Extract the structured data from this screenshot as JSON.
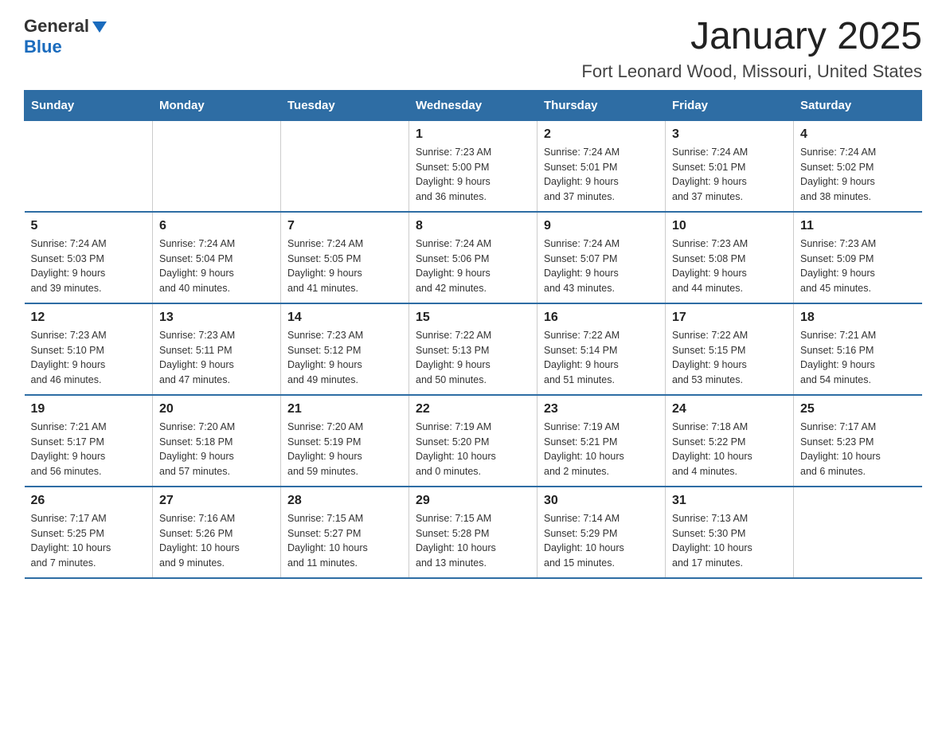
{
  "logo": {
    "general": "General",
    "blue": "Blue"
  },
  "title": "January 2025",
  "subtitle": "Fort Leonard Wood, Missouri, United States",
  "weekdays": [
    "Sunday",
    "Monday",
    "Tuesday",
    "Wednesday",
    "Thursday",
    "Friday",
    "Saturday"
  ],
  "weeks": [
    [
      {
        "day": "",
        "info": ""
      },
      {
        "day": "",
        "info": ""
      },
      {
        "day": "",
        "info": ""
      },
      {
        "day": "1",
        "info": "Sunrise: 7:23 AM\nSunset: 5:00 PM\nDaylight: 9 hours\nand 36 minutes."
      },
      {
        "day": "2",
        "info": "Sunrise: 7:24 AM\nSunset: 5:01 PM\nDaylight: 9 hours\nand 37 minutes."
      },
      {
        "day": "3",
        "info": "Sunrise: 7:24 AM\nSunset: 5:01 PM\nDaylight: 9 hours\nand 37 minutes."
      },
      {
        "day": "4",
        "info": "Sunrise: 7:24 AM\nSunset: 5:02 PM\nDaylight: 9 hours\nand 38 minutes."
      }
    ],
    [
      {
        "day": "5",
        "info": "Sunrise: 7:24 AM\nSunset: 5:03 PM\nDaylight: 9 hours\nand 39 minutes."
      },
      {
        "day": "6",
        "info": "Sunrise: 7:24 AM\nSunset: 5:04 PM\nDaylight: 9 hours\nand 40 minutes."
      },
      {
        "day": "7",
        "info": "Sunrise: 7:24 AM\nSunset: 5:05 PM\nDaylight: 9 hours\nand 41 minutes."
      },
      {
        "day": "8",
        "info": "Sunrise: 7:24 AM\nSunset: 5:06 PM\nDaylight: 9 hours\nand 42 minutes."
      },
      {
        "day": "9",
        "info": "Sunrise: 7:24 AM\nSunset: 5:07 PM\nDaylight: 9 hours\nand 43 minutes."
      },
      {
        "day": "10",
        "info": "Sunrise: 7:23 AM\nSunset: 5:08 PM\nDaylight: 9 hours\nand 44 minutes."
      },
      {
        "day": "11",
        "info": "Sunrise: 7:23 AM\nSunset: 5:09 PM\nDaylight: 9 hours\nand 45 minutes."
      }
    ],
    [
      {
        "day": "12",
        "info": "Sunrise: 7:23 AM\nSunset: 5:10 PM\nDaylight: 9 hours\nand 46 minutes."
      },
      {
        "day": "13",
        "info": "Sunrise: 7:23 AM\nSunset: 5:11 PM\nDaylight: 9 hours\nand 47 minutes."
      },
      {
        "day": "14",
        "info": "Sunrise: 7:23 AM\nSunset: 5:12 PM\nDaylight: 9 hours\nand 49 minutes."
      },
      {
        "day": "15",
        "info": "Sunrise: 7:22 AM\nSunset: 5:13 PM\nDaylight: 9 hours\nand 50 minutes."
      },
      {
        "day": "16",
        "info": "Sunrise: 7:22 AM\nSunset: 5:14 PM\nDaylight: 9 hours\nand 51 minutes."
      },
      {
        "day": "17",
        "info": "Sunrise: 7:22 AM\nSunset: 5:15 PM\nDaylight: 9 hours\nand 53 minutes."
      },
      {
        "day": "18",
        "info": "Sunrise: 7:21 AM\nSunset: 5:16 PM\nDaylight: 9 hours\nand 54 minutes."
      }
    ],
    [
      {
        "day": "19",
        "info": "Sunrise: 7:21 AM\nSunset: 5:17 PM\nDaylight: 9 hours\nand 56 minutes."
      },
      {
        "day": "20",
        "info": "Sunrise: 7:20 AM\nSunset: 5:18 PM\nDaylight: 9 hours\nand 57 minutes."
      },
      {
        "day": "21",
        "info": "Sunrise: 7:20 AM\nSunset: 5:19 PM\nDaylight: 9 hours\nand 59 minutes."
      },
      {
        "day": "22",
        "info": "Sunrise: 7:19 AM\nSunset: 5:20 PM\nDaylight: 10 hours\nand 0 minutes."
      },
      {
        "day": "23",
        "info": "Sunrise: 7:19 AM\nSunset: 5:21 PM\nDaylight: 10 hours\nand 2 minutes."
      },
      {
        "day": "24",
        "info": "Sunrise: 7:18 AM\nSunset: 5:22 PM\nDaylight: 10 hours\nand 4 minutes."
      },
      {
        "day": "25",
        "info": "Sunrise: 7:17 AM\nSunset: 5:23 PM\nDaylight: 10 hours\nand 6 minutes."
      }
    ],
    [
      {
        "day": "26",
        "info": "Sunrise: 7:17 AM\nSunset: 5:25 PM\nDaylight: 10 hours\nand 7 minutes."
      },
      {
        "day": "27",
        "info": "Sunrise: 7:16 AM\nSunset: 5:26 PM\nDaylight: 10 hours\nand 9 minutes."
      },
      {
        "day": "28",
        "info": "Sunrise: 7:15 AM\nSunset: 5:27 PM\nDaylight: 10 hours\nand 11 minutes."
      },
      {
        "day": "29",
        "info": "Sunrise: 7:15 AM\nSunset: 5:28 PM\nDaylight: 10 hours\nand 13 minutes."
      },
      {
        "day": "30",
        "info": "Sunrise: 7:14 AM\nSunset: 5:29 PM\nDaylight: 10 hours\nand 15 minutes."
      },
      {
        "day": "31",
        "info": "Sunrise: 7:13 AM\nSunset: 5:30 PM\nDaylight: 10 hours\nand 17 minutes."
      },
      {
        "day": "",
        "info": ""
      }
    ]
  ]
}
